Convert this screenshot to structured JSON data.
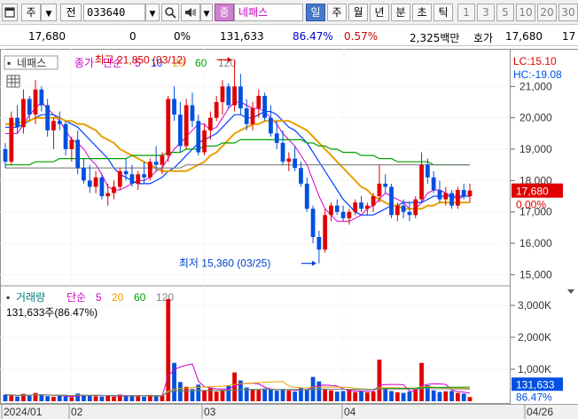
{
  "toolbar": {
    "menu_icon": "window-icon",
    "type_label": "주",
    "jeon_label": "전",
    "code": "033640",
    "jong_label": "종",
    "stock_name": "네패스",
    "period_buttons": [
      "일",
      "주",
      "월",
      "년",
      "분",
      "초",
      "틱"
    ],
    "period_selected": "일",
    "number_buttons": [
      "1",
      "3",
      "5",
      "10",
      "20",
      "30"
    ]
  },
  "quote": {
    "price": "17,680",
    "change": "0",
    "change_pct": "0%",
    "volume": "131,633",
    "volume_ratio": "86.47%",
    "turnover": "0.57%",
    "amount": "2,325백만",
    "ask_label": "호가",
    "ask_price": "17,680",
    "ask_tail": "17"
  },
  "chart": {
    "stock_label": "네패스",
    "price_ma_legend": {
      "kind": "종가",
      "method": "단순",
      "periods": [
        "5",
        "10",
        "20",
        "60",
        "120"
      ]
    },
    "volume_title": "거래량",
    "volume_ma_legend": {
      "method": "단순",
      "periods": [
        "5",
        "20",
        "60",
        "120"
      ]
    },
    "volume_summary": "131,633주(86.47%)",
    "high_marker": "최고 21,850 (03/12)",
    "low_marker": "최저 15,360 (03/25)",
    "lc_label": "LC:15.10",
    "hc_label": "HC:-19.08",
    "current_price_tag": "17,680",
    "current_pct_tag": "0.00%",
    "current_volume_tag": "131,633",
    "current_volume_pct_tag": "86.47%",
    "colors": {
      "up": "#e00000",
      "down": "#0050e0",
      "ma5": "#d000d0",
      "ma10": "#0040ff",
      "ma20": "#e8a000",
      "ma60": "#00a000",
      "ma120": "#808080"
    }
  },
  "chart_data": {
    "type": "candlestick",
    "x_tick_labels": [
      "2024/01",
      "02",
      "03",
      "04",
      "04/26"
    ],
    "price_ticks": [
      "21,000",
      "20,000",
      "19,000",
      "18,000",
      "17,000",
      "16,000",
      "15,000"
    ],
    "price_ylim": [
      14700,
      22000
    ],
    "volume_ticks": [
      "3,000K",
      "2,000K",
      "1,000K"
    ],
    "volume_ylim": [
      0,
      3500
    ],
    "ohlc": [
      [
        19000,
        19200,
        18400,
        18600
      ],
      [
        18600,
        20200,
        18500,
        20000
      ],
      [
        20000,
        20400,
        19500,
        19700
      ],
      [
        19700,
        20900,
        19500,
        20600
      ],
      [
        20600,
        20700,
        19900,
        20100
      ],
      [
        20100,
        21200,
        19800,
        20900
      ],
      [
        20900,
        21000,
        20200,
        20400
      ],
      [
        20400,
        20600,
        19400,
        19600
      ],
      [
        19600,
        20000,
        19000,
        19900
      ],
      [
        19900,
        20200,
        19600,
        19800
      ],
      [
        19800,
        19900,
        18800,
        19000
      ],
      [
        19000,
        19400,
        18600,
        19300
      ],
      [
        19300,
        19600,
        18200,
        18400
      ],
      [
        18400,
        18700,
        17900,
        18000
      ],
      [
        18000,
        18500,
        17600,
        17800
      ],
      [
        17800,
        18300,
        17600,
        18100
      ],
      [
        18100,
        18200,
        17400,
        17500
      ],
      [
        17500,
        17900,
        17200,
        17600
      ],
      [
        17600,
        18000,
        17400,
        17800
      ],
      [
        17800,
        18400,
        17700,
        18300
      ],
      [
        18300,
        18700,
        18000,
        18200
      ],
      [
        18200,
        18500,
        17800,
        17900
      ],
      [
        17900,
        18300,
        17700,
        18200
      ],
      [
        18200,
        18600,
        17900,
        18100
      ],
      [
        18100,
        18700,
        18000,
        18600
      ],
      [
        18600,
        19100,
        18300,
        18500
      ],
      [
        18500,
        18900,
        18200,
        18800
      ],
      [
        18800,
        20700,
        18600,
        20600
      ],
      [
        20600,
        21000,
        19900,
        20100
      ],
      [
        20100,
        20500,
        18900,
        19100
      ],
      [
        19100,
        20600,
        19000,
        20400
      ],
      [
        20400,
        20800,
        19700,
        19900
      ],
      [
        19900,
        20100,
        18800,
        18900
      ],
      [
        18900,
        19800,
        18800,
        19600
      ],
      [
        19600,
        20200,
        19300,
        20000
      ],
      [
        20000,
        20700,
        19900,
        20500
      ],
      [
        20500,
        21200,
        20100,
        21000
      ],
      [
        21000,
        21100,
        20300,
        20400
      ],
      [
        20400,
        21850,
        20200,
        21000
      ],
      [
        21000,
        21400,
        20100,
        20300
      ],
      [
        20300,
        20600,
        19600,
        19800
      ],
      [
        19800,
        20500,
        19600,
        20300
      ],
      [
        20300,
        20900,
        20000,
        20700
      ],
      [
        20700,
        20800,
        19900,
        20000
      ],
      [
        20000,
        20400,
        19400,
        19500
      ],
      [
        19500,
        19900,
        19000,
        19200
      ],
      [
        19200,
        19600,
        18500,
        18600
      ],
      [
        18600,
        18900,
        18300,
        18700
      ],
      [
        18700,
        19100,
        18300,
        18400
      ],
      [
        18400,
        18600,
        17800,
        17900
      ],
      [
        17900,
        18100,
        17000,
        17100
      ],
      [
        17100,
        17200,
        16000,
        16200
      ],
      [
        16200,
        16400,
        15360,
        15800
      ],
      [
        15800,
        17100,
        15700,
        16900
      ],
      [
        16900,
        17300,
        16700,
        17200
      ],
      [
        17200,
        17400,
        16900,
        17000
      ],
      [
        17000,
        17200,
        16700,
        16800
      ],
      [
        16800,
        17100,
        16600,
        17000
      ],
      [
        17000,
        17400,
        16900,
        17300
      ],
      [
        17300,
        17500,
        17000,
        17100
      ],
      [
        17100,
        17300,
        16900,
        17200
      ],
      [
        17200,
        17600,
        17000,
        17500
      ],
      [
        17500,
        18500,
        17300,
        17900
      ],
      [
        17900,
        18200,
        17600,
        17800
      ],
      [
        17800,
        17900,
        16800,
        16900
      ],
      [
        16900,
        17300,
        16700,
        17200
      ],
      [
        17200,
        17400,
        16800,
        17000
      ],
      [
        17000,
        17300,
        16700,
        16900
      ],
      [
        16900,
        17500,
        16800,
        17400
      ],
      [
        17400,
        18900,
        17300,
        18500
      ],
      [
        18500,
        18700,
        17900,
        18100
      ],
      [
        18100,
        18300,
        17600,
        17700
      ],
      [
        17700,
        18000,
        17300,
        17400
      ],
      [
        17400,
        17800,
        17200,
        17600
      ],
      [
        17600,
        17700,
        17100,
        17200
      ],
      [
        17200,
        17800,
        17100,
        17700
      ],
      [
        17700,
        17900,
        17400,
        17500
      ],
      [
        17500,
        17900,
        17300,
        17680
      ]
    ],
    "volume_k": [
      210,
      180,
      150,
      230,
      170,
      260,
      190,
      160,
      140,
      170,
      150,
      130,
      240,
      200,
      180,
      160,
      150,
      170,
      140,
      210,
      180,
      160,
      150,
      140,
      200,
      170,
      190,
      3200,
      1200,
      600,
      450,
      380,
      520,
      330,
      410,
      300,
      350,
      480,
      900,
      650,
      430,
      380,
      350,
      400,
      360,
      330,
      380,
      340,
      300,
      420,
      380,
      760,
      620,
      360,
      340,
      300,
      320,
      360,
      290,
      310,
      280,
      300,
      1300,
      420,
      320,
      280,
      260,
      300,
      380,
      1200,
      500,
      340,
      290,
      310,
      320,
      260,
      240,
      131.6
    ],
    "series": [
      {
        "name": "5",
        "values": [
          19500,
          19500,
          19500,
          19800,
          20100,
          20300,
          20500,
          20300,
          20100,
          19900,
          19600,
          19300,
          19200,
          19000,
          18700,
          18500,
          18200,
          17800,
          17700,
          17700,
          17800,
          17900,
          18000,
          18000,
          18100,
          18300,
          18400,
          18700,
          19000,
          19200,
          19400,
          19600,
          19800,
          19800,
          19600,
          19700,
          20000,
          20300,
          20500,
          20500,
          20400,
          20300,
          20300,
          20200,
          20000,
          19800,
          19500,
          19300,
          19100,
          18800,
          18500,
          18000,
          17500,
          17100,
          16900,
          16700,
          16700,
          16700,
          16800,
          16900,
          17100,
          17200,
          17400,
          17600,
          17500,
          17400,
          17300,
          17100,
          17100,
          17300,
          17600,
          17700,
          17700,
          17600,
          17500,
          17400,
          17500,
          17500
        ]
      },
      {
        "name": "10",
        "values": [
          19700,
          19700,
          19700,
          19800,
          19900,
          20000,
          20100,
          20100,
          20100,
          20000,
          19900,
          19800,
          19700,
          19500,
          19300,
          19100,
          18900,
          18700,
          18400,
          18200,
          18100,
          18000,
          17900,
          17900,
          17900,
          18000,
          18100,
          18300,
          18400,
          18600,
          18800,
          19000,
          19200,
          19300,
          19400,
          19500,
          19700,
          19900,
          20100,
          20100,
          20000,
          20000,
          20100,
          20200,
          20200,
          20100,
          19900,
          19700,
          19600,
          19400,
          19200,
          18900,
          18600,
          18300,
          18000,
          17700,
          17400,
          17200,
          17000,
          16900,
          16900,
          16900,
          17000,
          17100,
          17200,
          17200,
          17300,
          17300,
          17300,
          17300,
          17400,
          17500,
          17500,
          17500,
          17500,
          17500,
          17500,
          17500
        ]
      },
      {
        "name": "20",
        "values": [
          19800,
          19800,
          19800,
          19900,
          19900,
          20000,
          20000,
          20000,
          20000,
          20000,
          19900,
          19900,
          19800,
          19800,
          19700,
          19600,
          19400,
          19300,
          19200,
          19000,
          18900,
          18800,
          18700,
          18600,
          18500,
          18400,
          18300,
          18300,
          18300,
          18300,
          18300,
          18400,
          18500,
          18600,
          18800,
          18900,
          19100,
          19300,
          19500,
          19600,
          19700,
          19800,
          19800,
          19900,
          19900,
          19900,
          19900,
          19900,
          19800,
          19700,
          19600,
          19400,
          19200,
          19000,
          18800,
          18600,
          18400,
          18200,
          18000,
          17800,
          17700,
          17500,
          17400,
          17300,
          17200,
          17200,
          17100,
          17100,
          17100,
          17100,
          17200,
          17200,
          17300,
          17300,
          17300,
          17300,
          17300,
          17300
        ]
      },
      {
        "name": "60",
        "values": [
          18500,
          18500,
          18500,
          18500,
          18500,
          18600,
          18600,
          18600,
          18600,
          18700,
          18700,
          18700,
          18700,
          18700,
          18700,
          18700,
          18700,
          18700,
          18700,
          18700,
          18700,
          18800,
          18800,
          18800,
          18800,
          18800,
          18800,
          18900,
          18900,
          18900,
          19000,
          19000,
          19000,
          19100,
          19100,
          19100,
          19200,
          19200,
          19200,
          19300,
          19300,
          19300,
          19300,
          19300,
          19300,
          19300,
          19300,
          19300,
          19300,
          19300,
          19200,
          19200,
          19100,
          19100,
          19000,
          19000,
          18900,
          18900,
          18900,
          18800,
          18800,
          18800,
          18700,
          18700,
          18700,
          18600,
          18600,
          18600,
          18600,
          18600,
          18600,
          18500,
          18500,
          18500,
          18500,
          18500,
          18500,
          18500
        ]
      },
      {
        "name": "120",
        "values": [
          18400,
          18400,
          18400,
          18400,
          18400,
          18400,
          18400,
          18400,
          18400,
          18400,
          18400,
          18400,
          18400,
          18400,
          18400,
          18400,
          18400,
          18400,
          18400,
          18400,
          18400,
          18400,
          18400,
          18400,
          18400,
          18400,
          18400,
          18400,
          18400,
          18400,
          18500,
          18500,
          18500,
          18500,
          18500,
          18500,
          18500,
          18500,
          18500,
          18500,
          18500,
          18500,
          18500,
          18500,
          18500,
          18500,
          18500,
          18500,
          18500,
          18500,
          18500,
          18500,
          18500,
          18500,
          18500,
          18500,
          18500,
          18500,
          18500,
          18500,
          18500,
          18500,
          18500,
          18500,
          18500,
          18500,
          18500,
          18500,
          18500,
          18500,
          18500,
          18500,
          18500,
          18500,
          18500,
          18500,
          18500,
          18500
        ]
      }
    ]
  }
}
